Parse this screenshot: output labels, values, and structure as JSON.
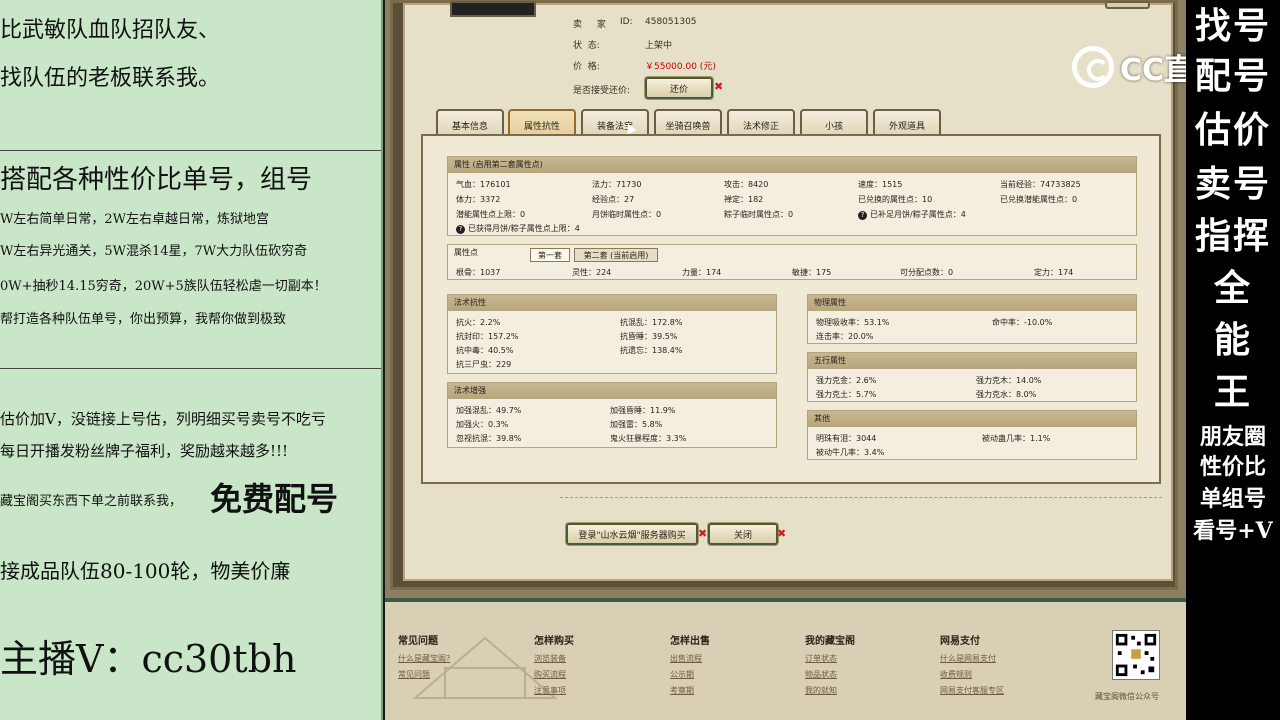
{
  "left_panel": {
    "line1": "比武敏队血队招队友、",
    "line2": "找队伍的老板联系我。",
    "line3": "搭配各种性价比单号，组号",
    "line4": "W左右简单日常，2W左右卓越日常，炼狱地宫",
    "line5": "W左右异光通关，5W混杀14星，7W大力队伍砍穷奇",
    "line6": "0W+抽秒14.15穷奇，20W+5族队伍轻松虐一切副本！",
    "line7": "帮打造各种队伍单号，你出预算，我帮你做到极致",
    "line8": "估价加V，没链接上号估，列明细买号卖号不吃亏",
    "line9": "每日开播发粉丝牌子福利，奖励越来越多!!!",
    "line10_small": "藏宝阁买东西下单之前联系我，",
    "line10_big": "免费配号",
    "line11": "接成品队伍80-100轮，物美价廉",
    "line12": "主播V：cc30tbh"
  },
  "right_panel": {
    "big_lines": [
      "找号",
      "配号",
      "估价",
      "卖号",
      "指挥",
      "全",
      "能",
      "王"
    ],
    "small_lines": [
      "朋友圈",
      "性价比",
      "单组号",
      "看号+V"
    ]
  },
  "stream_logo": "CC直播",
  "listing": {
    "seller_label": "卖 家",
    "seller_id_label": "ID:",
    "seller_id": "458051305",
    "status_label": "状  态:",
    "status_value": "上架中",
    "price_label": "价  格:",
    "price_value": "￥55000.00 (元)",
    "counter_offer_label": "是否接受还价:",
    "counter_offer_button": "还价"
  },
  "tabs": [
    "基本信息",
    "属性抗性",
    "装备法宝",
    "坐骑召唤兽",
    "法术修正",
    "小孩",
    "外观道具"
  ],
  "attributes": {
    "title": "属性 (启用第二套属性点)",
    "row1": [
      "气血：176101",
      "法力：71730",
      "攻击：8420",
      "速度：1515",
      "当前经验：74733825"
    ],
    "row2": [
      "体力：3372",
      "经验点：27",
      "禅定：182",
      "已兑换的属性点：10",
      "已兑换潜能属性点：0"
    ],
    "row3": [
      "潜能属性点上限：0",
      "月饼临时属性点：0",
      "粽子临时属性点：0",
      "已补足月饼/粽子属性点：4"
    ],
    "row4": "已获得月饼/粽子属性点上限：4"
  },
  "points": {
    "title": "属性点",
    "subtab1": "第一套",
    "subtab2": "第二套 (当前启用)",
    "values": [
      "根骨：1037",
      "灵性：224",
      "力量：174",
      "敏捷：175",
      "可分配点数：0",
      "定力：174"
    ]
  },
  "resist": {
    "title": "法术抗性",
    "rows": [
      [
        "抗火：2.2%",
        "抗混乱：172.8%"
      ],
      [
        "抗封印：157.2%",
        "抗昏睡：39.5%"
      ],
      [
        "抗中毒：40.5%",
        "抗遗忘：138.4%"
      ],
      [
        "抗三尸虫：229",
        ""
      ]
    ]
  },
  "boost": {
    "title": "法术增强",
    "rows": [
      [
        "加强混乱：49.7%",
        "加强昏睡：11.9%"
      ],
      [
        "加强火：0.3%",
        "加强雷：5.8%"
      ],
      [
        "忽视抗混：39.8%",
        "鬼火狂暴程度：3.3%"
      ]
    ]
  },
  "physical": {
    "title": "物理属性",
    "rows": [
      [
        "物理吸收率：53.1%",
        "命中率：-10.0%"
      ],
      [
        "连击率：20.0%",
        ""
      ]
    ]
  },
  "five_elements": {
    "title": "五行属性",
    "rows": [
      [
        "强力克金：2.6%",
        "强力克木：14.0%"
      ],
      [
        "强力克土：5.7%",
        "强力克水：8.0%"
      ]
    ]
  },
  "other": {
    "title": "其他",
    "rows": [
      [
        "明珠有泪：3044",
        "被动蛊几率：1.1%"
      ],
      [
        "被动牛几率：3.4%",
        ""
      ]
    ]
  },
  "buttons": {
    "login_buy": "登录\"山水云烟\"服务器购买",
    "close": "关闭"
  },
  "footer": {
    "columns": [
      {
        "title": "常见问题",
        "links": [
          "什么是藏宝阁?",
          "常见问题"
        ]
      },
      {
        "title": "怎样购买",
        "links": [
          "浏览装备",
          "购买流程",
          "注意事项"
        ]
      },
      {
        "title": "怎样出售",
        "links": [
          "出售流程",
          "公示期",
          "考察期"
        ]
      },
      {
        "title": "我的藏宝阁",
        "links": [
          "订单状态",
          "物品状态",
          "我的就知"
        ]
      },
      {
        "title": "网易支付",
        "links": [
          "什么是网易支付",
          "收费规则",
          "网易支付客服专区"
        ]
      }
    ],
    "qr_caption": "藏宝阁微信公众号"
  },
  "colors": {
    "left_bg": "#c9e6c9",
    "right_bg": "#000000",
    "price": "#c40000",
    "accent_green": "#3d5a4a"
  }
}
